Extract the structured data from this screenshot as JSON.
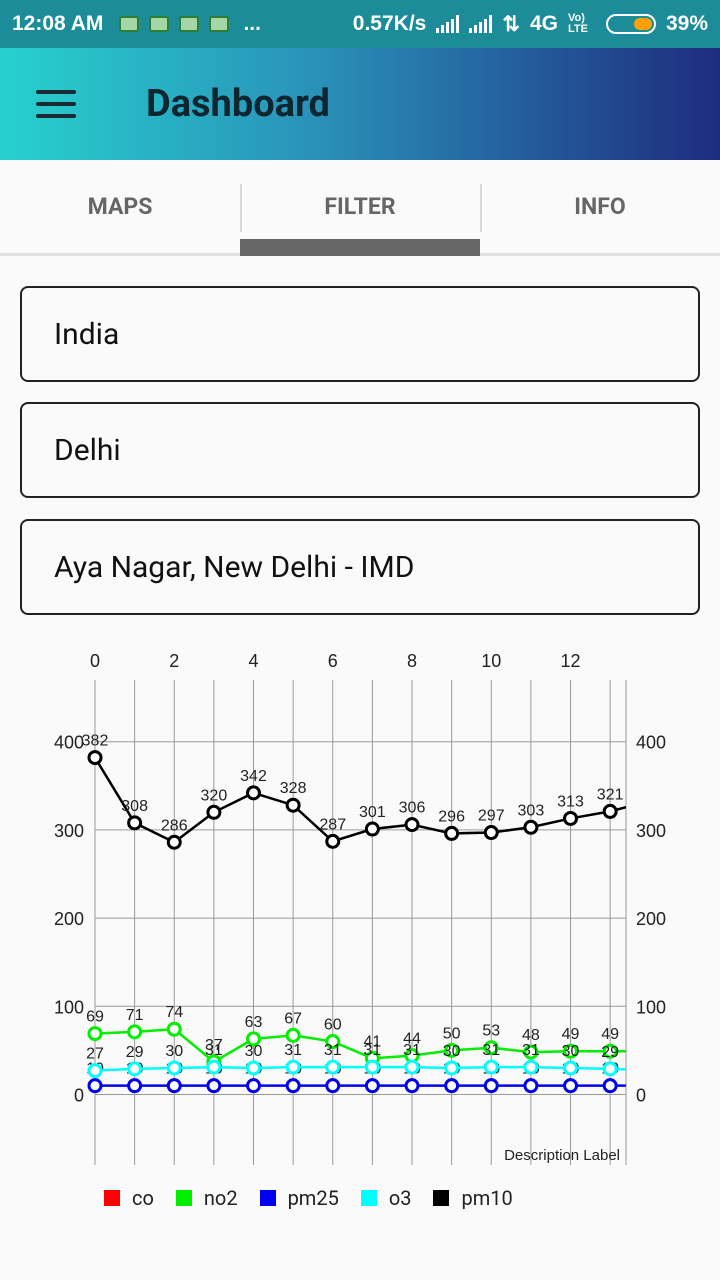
{
  "status": {
    "time": "12:08 AM",
    "more": "...",
    "speed": "0.57K/s",
    "network": "4G",
    "volte": "Vo) LTE",
    "battery": "39%",
    "battery_level": 0.39
  },
  "appbar": {
    "title": "Dashboard"
  },
  "tabs": [
    {
      "label": "MAPS"
    },
    {
      "label": "FILTER",
      "active": true
    },
    {
      "label": "INFO"
    }
  ],
  "filters": {
    "country": "India",
    "city": "Delhi",
    "station": "Aya Nagar, New Delhi - IMD"
  },
  "chart_data": {
    "type": "line",
    "x": [
      0,
      1,
      2,
      3,
      4,
      5,
      6,
      7,
      8,
      9,
      10,
      11,
      12,
      13
    ],
    "xlim": [
      0,
      13.4
    ],
    "ylim": [
      -80,
      470
    ],
    "x_ticks": [
      0,
      2,
      4,
      6,
      8,
      10,
      12
    ],
    "y_ticks": [
      0,
      100,
      200,
      300,
      400
    ],
    "grid": true,
    "description": "Description Label",
    "legend_position": "bottom-left",
    "series": [
      {
        "name": "co",
        "color": "#ff0000",
        "values": []
      },
      {
        "name": "no2",
        "color": "#00ee00",
        "values": [
          69,
          71,
          74,
          37,
          63,
          67,
          60,
          41,
          44,
          50,
          53,
          48,
          49,
          49
        ],
        "labels": [
          "69",
          "71",
          "74",
          "37",
          "63",
          "67",
          "60",
          "41",
          "44",
          "50",
          "53",
          "48",
          "49",
          "49"
        ]
      },
      {
        "name": "pm25",
        "color": "#0000ee",
        "values": [
          10,
          10,
          10,
          10,
          10,
          10,
          10,
          10,
          10,
          10,
          10,
          10,
          10,
          10
        ],
        "labels": [
          "10",
          "10",
          "10",
          "10",
          "10",
          "10",
          "10",
          "10",
          "10",
          "10",
          "10",
          "10",
          "10",
          "10"
        ]
      },
      {
        "name": "o3",
        "color": "#00ffff",
        "values": [
          27,
          29,
          30,
          31,
          30,
          31,
          31,
          31,
          31,
          30,
          31,
          31,
          30,
          29
        ],
        "labels": [
          "27",
          "29",
          "30",
          "31",
          "30",
          "31",
          "31",
          "31",
          "31",
          "30",
          "31",
          "31",
          "30",
          "29"
        ]
      },
      {
        "name": "pm10",
        "color": "#000000",
        "values": [
          382,
          308,
          286,
          320,
          342,
          328,
          287,
          301,
          306,
          296,
          297,
          303,
          313,
          321
        ],
        "labels": [
          "382",
          "308",
          "286",
          "320",
          "342",
          "328",
          "287",
          "301",
          "306",
          "296",
          "297",
          "303",
          "313",
          "321"
        ]
      }
    ]
  }
}
